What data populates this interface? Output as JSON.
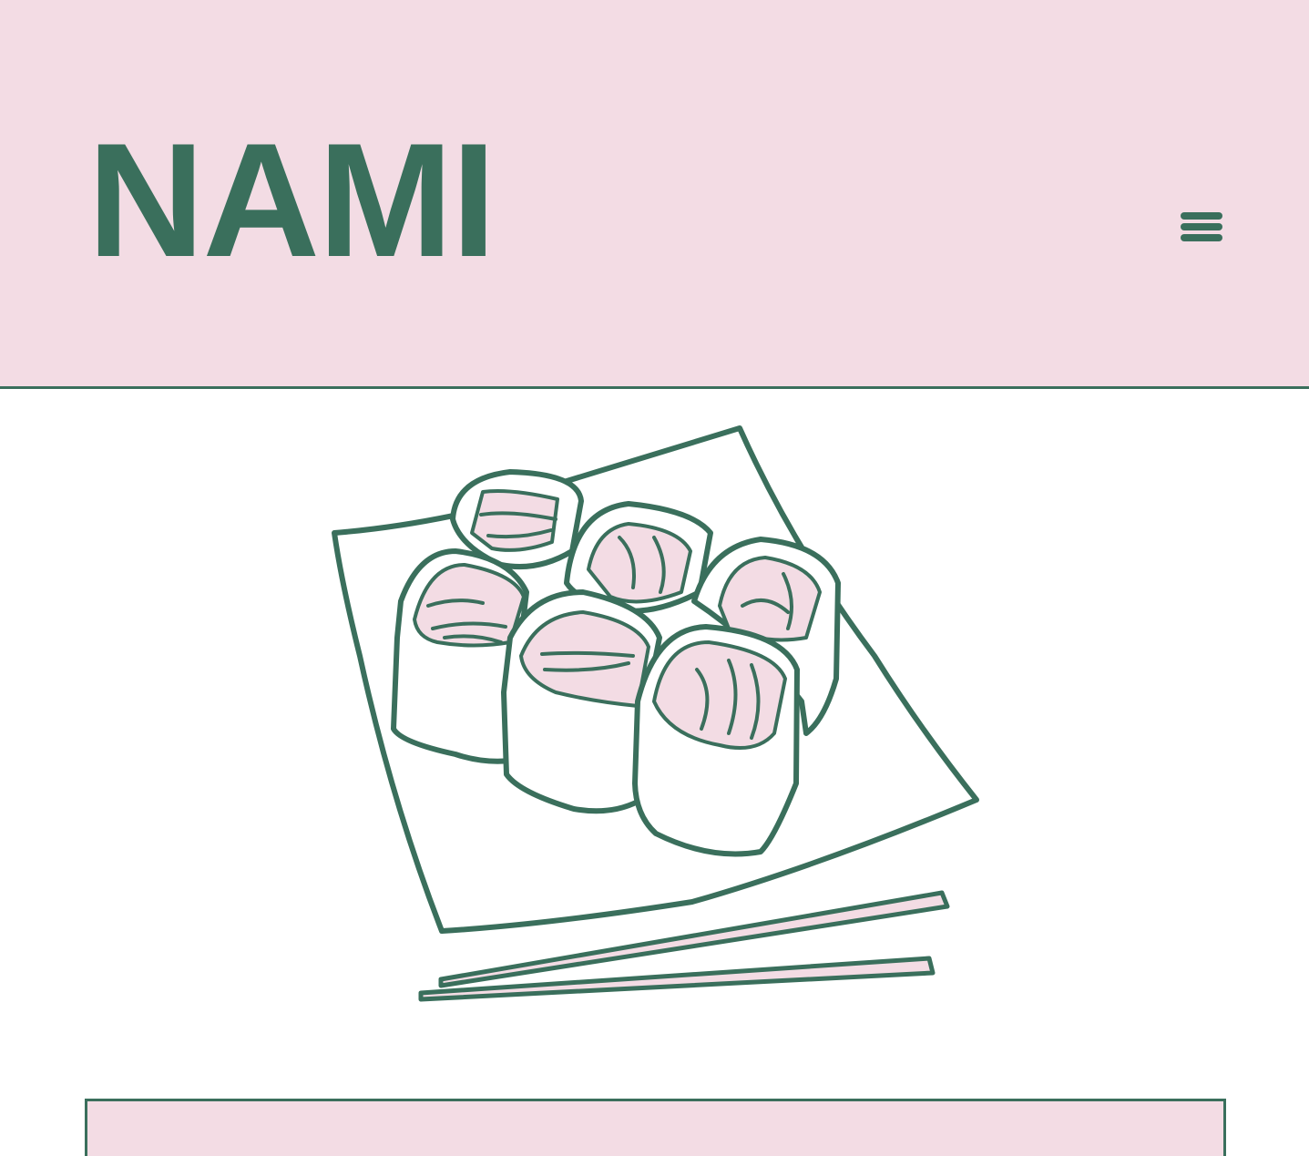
{
  "header": {
    "logo_text": "NAMI",
    "menu_icon": "hamburger-menu-icon"
  },
  "hero": {
    "illustration": "sushi-rolls-on-plate-with-chopsticks"
  },
  "colors": {
    "header_background": "#f3dce4",
    "brand_green": "#3a6f5c",
    "filling_pink": "#f3dce4",
    "page_background": "#ffffff"
  }
}
